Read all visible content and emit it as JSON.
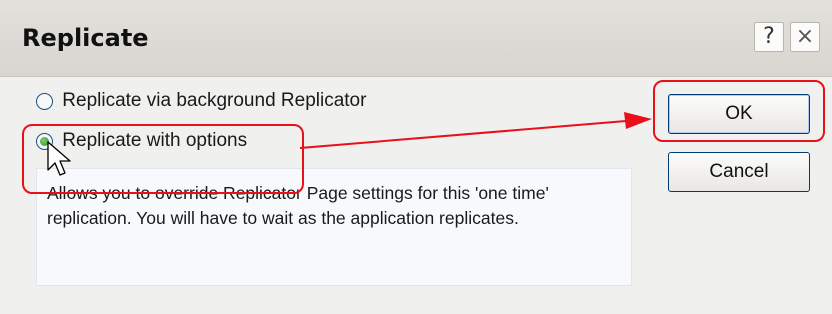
{
  "window": {
    "title": "Replicate",
    "help_label": "?",
    "close_label": "×"
  },
  "options": [
    {
      "label": "Replicate via background Replicator",
      "selected": false
    },
    {
      "label": "Replicate with options",
      "selected": true
    }
  ],
  "description": "Allows you to override Replicator Page settings for this 'one time' replication.  You will have to wait as the application replicates.",
  "buttons": {
    "ok_label": "OK",
    "cancel_label": "Cancel"
  },
  "annotation": {
    "color": "#e81019",
    "cursor": "arrow-pointer-icon"
  }
}
